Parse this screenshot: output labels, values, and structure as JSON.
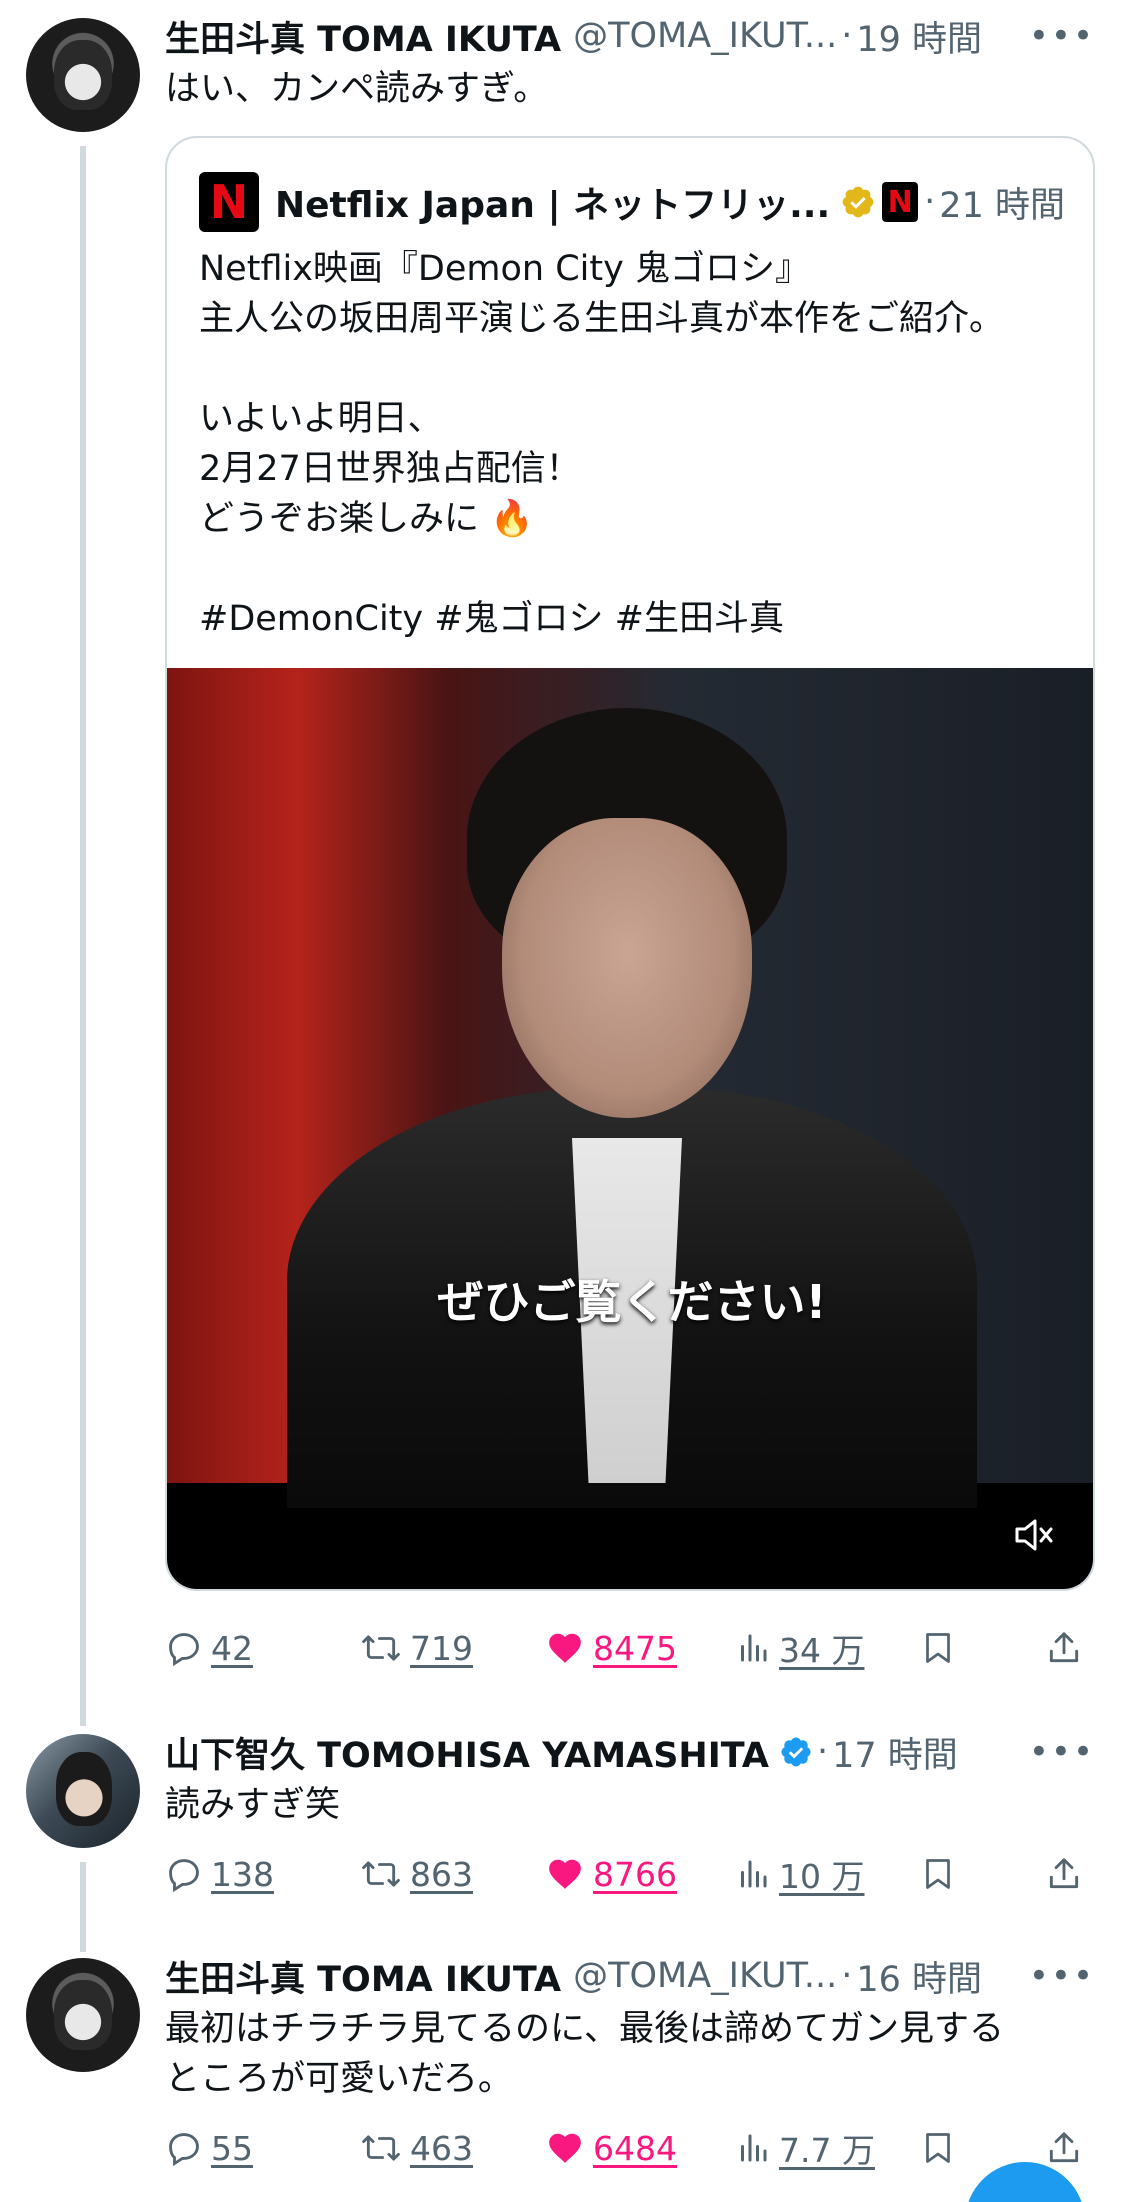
{
  "thread": [
    {
      "author": "生田斗真 TOMA IKUTA",
      "handle": "@TOMA_IKUT...",
      "time": "19 時間",
      "text": "はい、カンペ読みすぎ。",
      "quote": {
        "author": "Netflix Japan | ネットフリッ...",
        "time": "21 時間",
        "logo_letter": "N",
        "lines": [
          "Netflix映画『Demon City 鬼ゴロシ』",
          "主人公の坂田周平演じる生田斗真が本作をご紹介。",
          "",
          "いよいよ明日、",
          "2月27日世界独占配信！",
          "どうぞお楽しみに 🔥",
          "",
          "#DemonCity #鬼ゴロシ #生田斗真"
        ],
        "video_subtitle": "ぜひご覧ください!"
      },
      "replies": "42",
      "reposts": "719",
      "likes": "8475",
      "views": "34 万"
    },
    {
      "author": "山下智久 TOMOHISA YAMASHITA",
      "time": "17 時間",
      "text": "読みすぎ笑",
      "replies": "138",
      "reposts": "863",
      "likes": "8766",
      "views": "10 万"
    },
    {
      "author": "生田斗真 TOMA IKUTA",
      "handle": "@TOMA_IKUT...",
      "time": "16 時間",
      "text_lines": [
        "最初はチラチラ見てるのに、最後は諦めてガン見する",
        "ところが可愛いだろ。"
      ],
      "replies": "55",
      "reposts": "463",
      "likes": "6484",
      "views": "7.7 万"
    }
  ],
  "ui": {
    "separator": "·",
    "more_glyph": "•••"
  },
  "colors": {
    "like": "#f91880",
    "secondary": "#536471",
    "verified_blue": "#1d9bf0",
    "verified_gold": "#e2b719",
    "netflix_red": "#e50914"
  }
}
